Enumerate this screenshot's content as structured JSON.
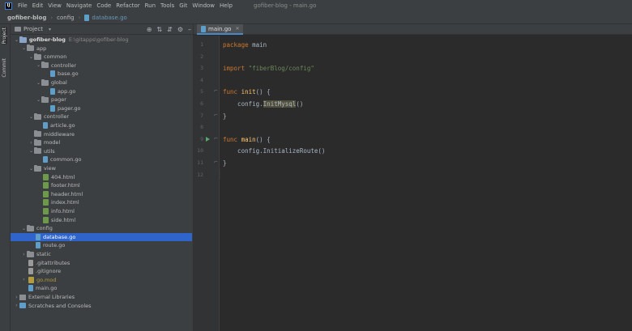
{
  "menubar": {
    "logo": "IJ",
    "items": [
      "File",
      "Edit",
      "View",
      "Navigate",
      "Code",
      "Refactor",
      "Run",
      "Tools",
      "Git",
      "Window",
      "Help"
    ],
    "window_title": "gofiber-blog - main.go"
  },
  "breadcrumb": {
    "root": "gofiber-blog",
    "folder": "config",
    "file": "database.go"
  },
  "tool_strip": {
    "project_tab": "Project",
    "commit_tab": "Commit"
  },
  "project_panel": {
    "title": "Project",
    "header_icons": [
      "target-icon",
      "collapse-icon",
      "expand-icon",
      "gear-icon",
      "minimize-icon"
    ],
    "tree": [
      {
        "label": "gofiber-blog",
        "hint": "E:\\gitapps\\gofiber-blog",
        "type": "root",
        "depth": 0,
        "expanded": true
      },
      {
        "label": "app",
        "type": "folder",
        "depth": 1,
        "expanded": true
      },
      {
        "label": "common",
        "type": "folder",
        "depth": 2,
        "expanded": true
      },
      {
        "label": "controller",
        "type": "folder",
        "depth": 3,
        "expanded": true
      },
      {
        "label": "base.go",
        "type": "go",
        "depth": 4
      },
      {
        "label": "global",
        "type": "folder",
        "depth": 3,
        "expanded": true
      },
      {
        "label": "app.go",
        "type": "go",
        "depth": 4
      },
      {
        "label": "pager",
        "type": "folder",
        "depth": 3,
        "expanded": true
      },
      {
        "label": "pager.go",
        "type": "go",
        "depth": 4
      },
      {
        "label": "controller",
        "type": "folder",
        "depth": 2,
        "expanded": true
      },
      {
        "label": "article.go",
        "type": "go",
        "depth": 3
      },
      {
        "label": "middleware",
        "type": "folder",
        "depth": 2,
        "expanded": false,
        "leaf": true
      },
      {
        "label": "model",
        "type": "folder",
        "depth": 2,
        "expanded": false
      },
      {
        "label": "utils",
        "type": "folder",
        "depth": 2,
        "expanded": true
      },
      {
        "label": "common.go",
        "type": "go",
        "depth": 3
      },
      {
        "label": "view",
        "type": "folder",
        "depth": 2,
        "expanded": true
      },
      {
        "label": "404.html",
        "type": "html",
        "depth": 3
      },
      {
        "label": "footer.html",
        "type": "html",
        "depth": 3
      },
      {
        "label": "header.html",
        "type": "html",
        "depth": 3
      },
      {
        "label": "index.html",
        "type": "html",
        "depth": 3
      },
      {
        "label": "info.html",
        "type": "html",
        "depth": 3
      },
      {
        "label": "side.html",
        "type": "html",
        "depth": 3
      },
      {
        "label": "config",
        "type": "folder",
        "depth": 1,
        "expanded": true
      },
      {
        "label": "database.go",
        "type": "go",
        "depth": 2,
        "selected": true
      },
      {
        "label": "route.go",
        "type": "go",
        "depth": 2
      },
      {
        "label": "static",
        "type": "folder",
        "depth": 1,
        "expanded": false
      },
      {
        "label": ".gitattributes",
        "type": "txt",
        "depth": 1
      },
      {
        "label": ".gitignore",
        "type": "txt",
        "depth": 1
      },
      {
        "label": "go.mod",
        "type": "mod",
        "depth": 1,
        "expanded": false
      },
      {
        "label": "main.go",
        "type": "go",
        "depth": 1
      },
      {
        "label": "External Libraries",
        "type": "lib",
        "depth": 0,
        "expanded": false
      },
      {
        "label": "Scratches and Consoles",
        "type": "scratch",
        "depth": 0,
        "expanded": false
      }
    ]
  },
  "editor": {
    "tab_label": "main.go",
    "current_line": 12,
    "lines": [
      {
        "n": "1",
        "tokens": [
          {
            "t": "package ",
            "c": "kw"
          },
          {
            "t": "main",
            "c": "pkg"
          }
        ]
      },
      {
        "n": "2",
        "tokens": []
      },
      {
        "n": "3",
        "tokens": [
          {
            "t": "import ",
            "c": "kw"
          },
          {
            "t": "\"fiberBlog/config\"",
            "c": "str"
          }
        ]
      },
      {
        "n": "4",
        "tokens": []
      },
      {
        "n": "5",
        "fold": true,
        "tokens": [
          {
            "t": "func ",
            "c": "kw"
          },
          {
            "t": "init",
            "c": "fn"
          },
          {
            "t": "() {",
            "c": "call"
          }
        ]
      },
      {
        "n": "6",
        "tokens": [
          {
            "t": "    config.",
            "c": "call"
          },
          {
            "t": "InitMysql",
            "c": "hl"
          },
          {
            "t": "()",
            "c": "call"
          }
        ]
      },
      {
        "n": "7",
        "fold": true,
        "tokens": [
          {
            "t": "}",
            "c": "call"
          }
        ]
      },
      {
        "n": "8",
        "tokens": []
      },
      {
        "n": "9",
        "run": true,
        "fold": true,
        "tokens": [
          {
            "t": "func ",
            "c": "kw"
          },
          {
            "t": "main",
            "c": "fn"
          },
          {
            "t": "() {",
            "c": "call"
          }
        ]
      },
      {
        "n": "10",
        "tokens": [
          {
            "t": "    config.InitializeRoute()",
            "c": "call"
          }
        ]
      },
      {
        "n": "11",
        "fold": true,
        "tokens": [
          {
            "t": "}",
            "c": "call"
          }
        ]
      },
      {
        "n": "12",
        "tokens": []
      }
    ]
  }
}
